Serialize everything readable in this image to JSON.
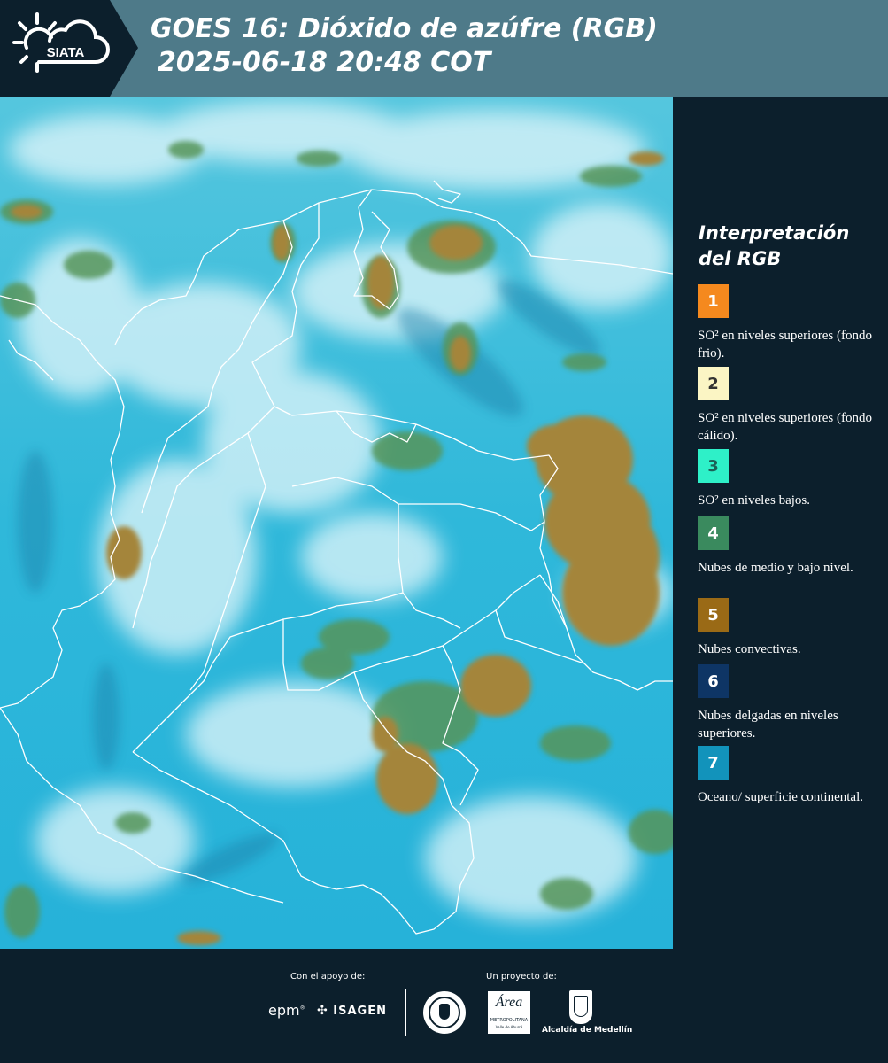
{
  "header": {
    "logo_text": "SIATA",
    "title_line1": "GOES 16: Dióxido de azúfre (RGB)",
    "title_line2": "2025-06-18 20:48 COT"
  },
  "legend": {
    "title": "Interpretación del RGB",
    "items": [
      {
        "number": "1",
        "color": "#f5891e",
        "text_color": "#ffffff",
        "label": "SO² en niveles superiores (fondo frio)."
      },
      {
        "number": "2",
        "color": "#fbf5c4",
        "text_color": "#333333",
        "label": "SO² en niveles superiores (fondo cálido)."
      },
      {
        "number": "3",
        "color": "#2ef0c8",
        "text_color": "#1c5f56",
        "label": "SO² en niveles bajos."
      },
      {
        "number": "4",
        "color": "#3a8a5e",
        "text_color": "#ffffff",
        "label": "Nubes de medio y bajo nivel."
      },
      {
        "number": "5",
        "color": "#9a6a16",
        "text_color": "#ffffff",
        "label": "Nubes convectivas."
      },
      {
        "number": "6",
        "color": "#0e3565",
        "text_color": "#ffffff",
        "label": "Nubes delgadas en niveles superiores."
      },
      {
        "number": "7",
        "color": "#1293bb",
        "text_color": "#ffffff",
        "label": "Oceano/ superficie continental."
      }
    ]
  },
  "footer": {
    "support_label": "Con el apoyo de:",
    "project_label": "Un proyecto de:",
    "epm": "epm",
    "isagen": "ISAGEN",
    "area_name": "Área",
    "area_sub": "METROPOLITANA",
    "area_sub2": "Valle de Aburrá",
    "alcaldia": "Alcaldía de Medellín"
  },
  "colors": {
    "background": "#0c1f2c",
    "title_band": "#4e7a89",
    "ocean": "#27b4d8",
    "cloud_white": "#e6f8fb",
    "convective": "#a9842e",
    "midlevel": "#4f9a5c"
  }
}
